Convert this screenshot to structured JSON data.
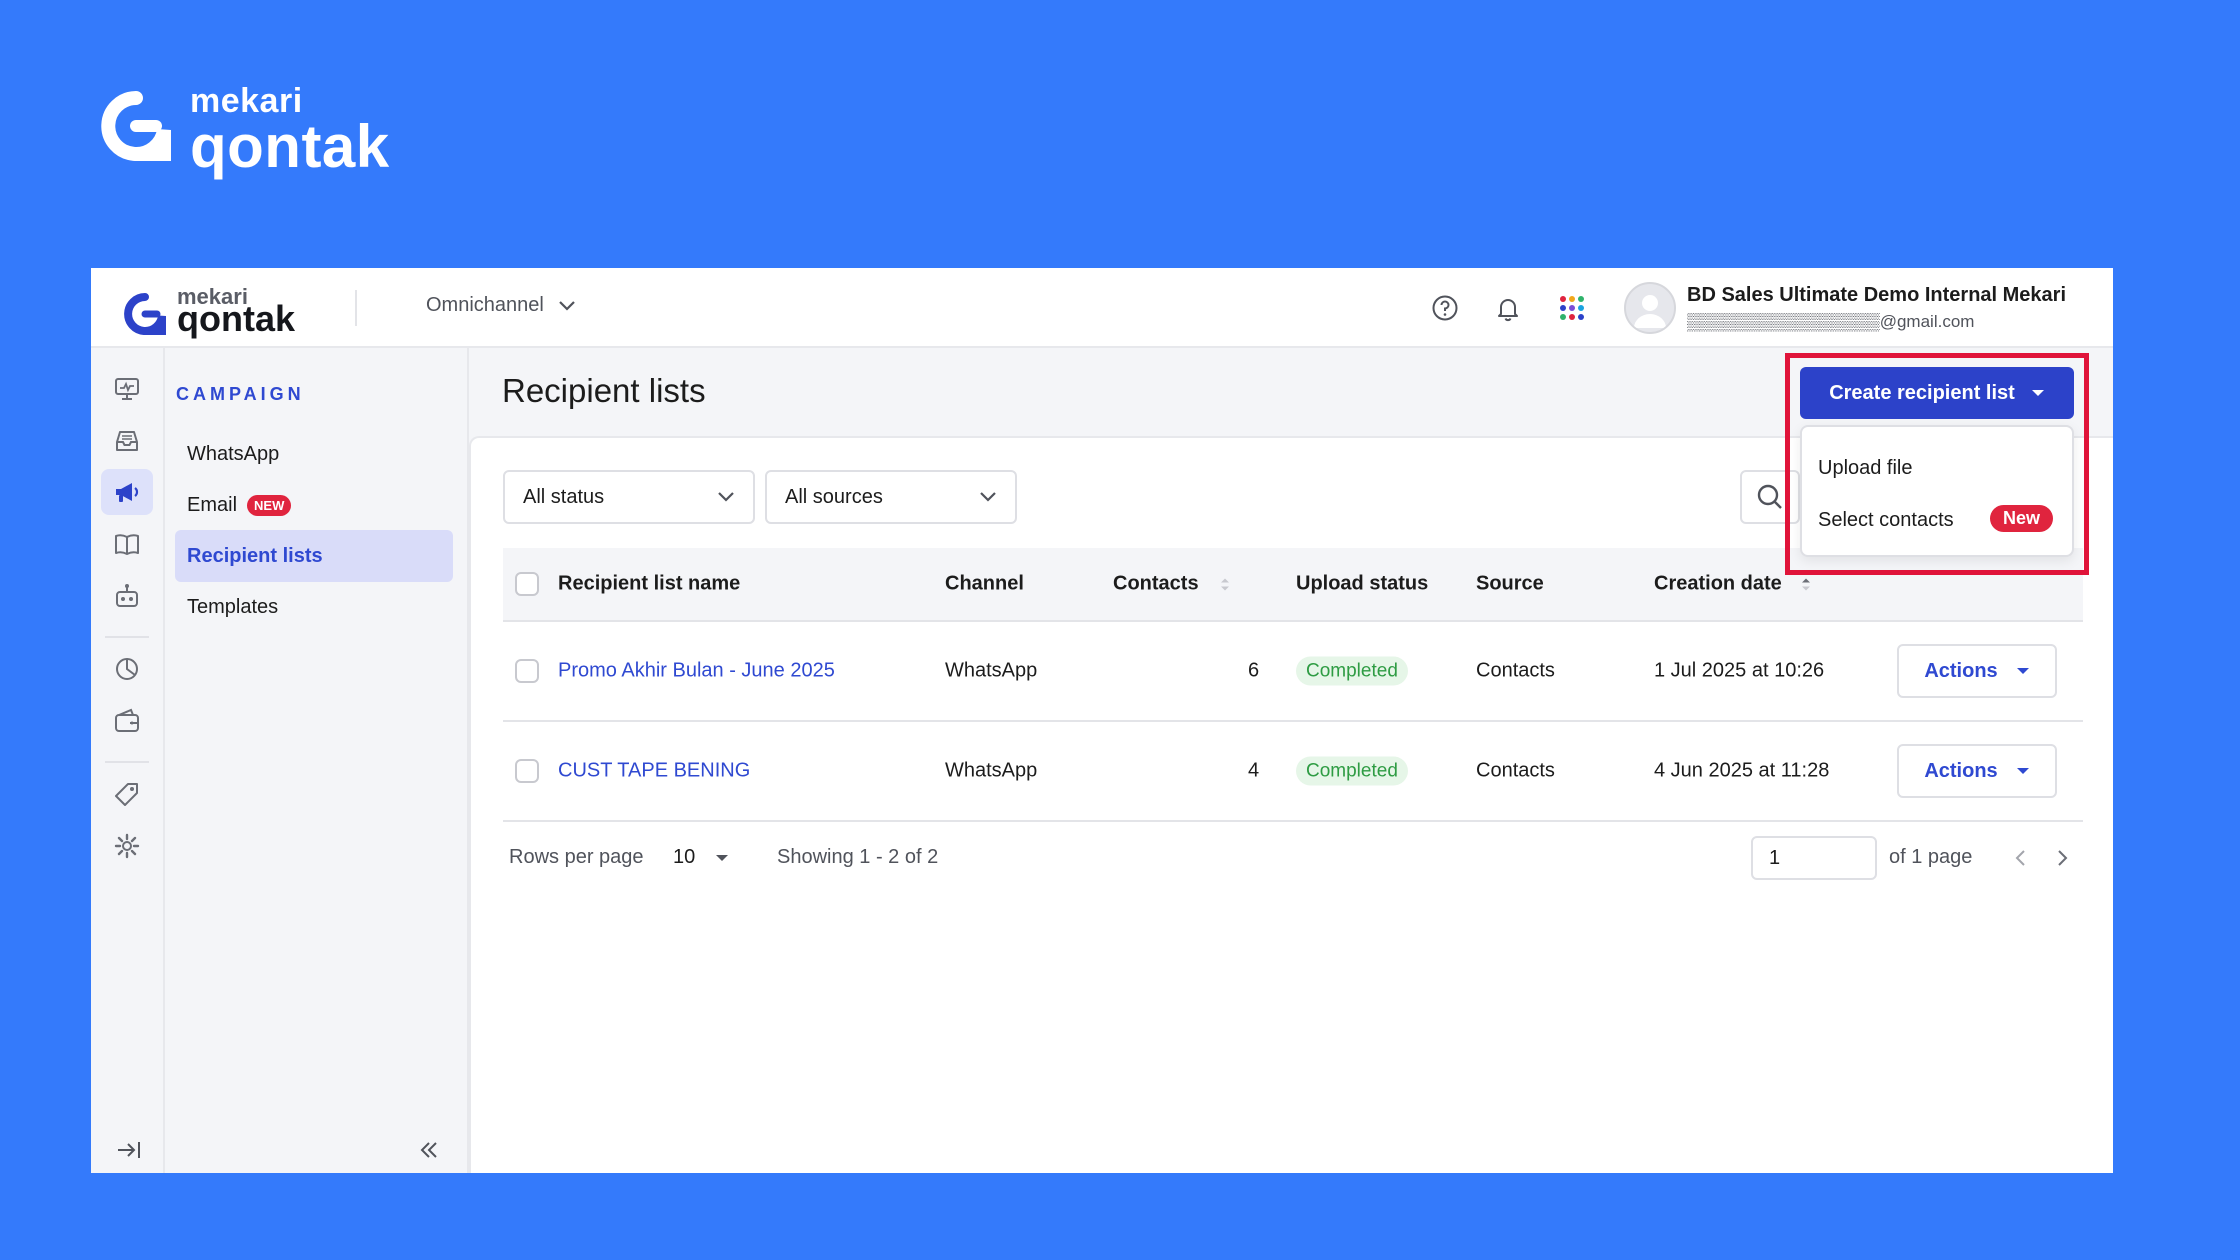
{
  "brand": {
    "word1": "mekari",
    "word2": "qontak"
  },
  "topbar": {
    "logo_word1": "mekari",
    "logo_word2": "qontak",
    "workspace_selector": "Omnichannel",
    "user_name": "BD Sales Ultimate Demo Internal Mekari",
    "user_email": "▒▒▒▒▒▒▒▒▒▒▒▒▒▒▒▒@gmail.com",
    "icons": [
      "help-icon",
      "bell-icon",
      "app-grid-icon"
    ]
  },
  "rail": {
    "icons": [
      "dashboard-icon",
      "inbox-icon",
      "megaphone-icon",
      "book-icon",
      "bot-icon",
      "chart-icon",
      "wallet-icon",
      "tag-icon",
      "settings-icon"
    ],
    "active": "megaphone-icon"
  },
  "sidebar": {
    "section_title": "CAMPAIGN",
    "items": [
      {
        "label": "WhatsApp"
      },
      {
        "label": "Email",
        "badge": "NEW"
      },
      {
        "label": "Recipient lists",
        "active": true
      },
      {
        "label": "Templates"
      }
    ]
  },
  "page": {
    "title": "Recipient lists",
    "create_button": "Create recipient list",
    "create_menu": {
      "items": [
        {
          "label": "Upload file"
        },
        {
          "label": "Select contacts",
          "badge": "New"
        }
      ]
    },
    "filters": {
      "status": "All status",
      "source": "All sources"
    }
  },
  "table": {
    "headers": {
      "name": "Recipient list name",
      "channel": "Channel",
      "contacts": "Contacts",
      "upload_status": "Upload status",
      "source": "Source",
      "creation_date": "Creation date"
    },
    "rows": [
      {
        "name": "Promo Akhir Bulan - June 2025",
        "channel": "WhatsApp",
        "contacts": "6",
        "upload_status": "Completed",
        "source": "Contacts",
        "creation_date": "1 Jul 2025 at 10:26",
        "action": "Actions"
      },
      {
        "name": "CUST TAPE BENING",
        "channel": "WhatsApp",
        "contacts": "4",
        "upload_status": "Completed",
        "source": "Contacts",
        "creation_date": "4 Jun 2025 at 11:28",
        "action": "Actions"
      }
    ]
  },
  "pagination": {
    "rows_per_page_label": "Rows per page",
    "rows_per_page": "10",
    "showing": "Showing 1 - 2 of 2",
    "current_page": "1",
    "of_pages": "of 1 page"
  },
  "colors": {
    "background": "#347AFB",
    "accent": "#2C42C9",
    "highlight": "#E0143A",
    "success": "#2E9C43"
  }
}
